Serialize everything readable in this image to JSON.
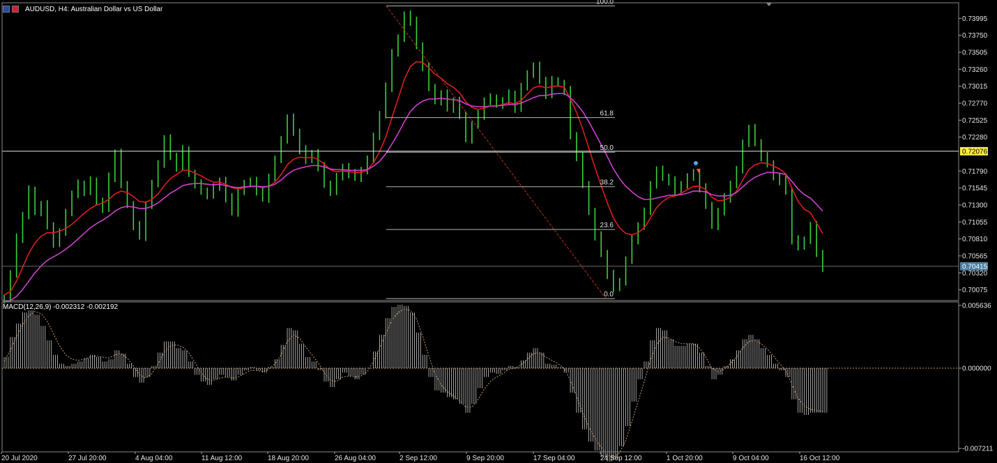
{
  "window": {
    "symbol_title": "AUDUSD, H4:  Australian Dollar vs US Dollar",
    "flag_icons": [
      "flag-au-icon",
      "flag-us-icon"
    ]
  },
  "macd_header": "MACD(12,26,9) -0.002312 -0.002192",
  "colors": {
    "background": "#000000",
    "candle": "#3cd23c",
    "ma_fast": "#e01e1e",
    "ma_slow": "#d040d0",
    "fib": "#b8b8b8",
    "fib_diagonal": "#b4321e",
    "macd_hist": "#d0d0d0",
    "macd_signal": "#c89a6a",
    "current_price_bg": "#4b7da0",
    "hline_price_bg": "#ffee44"
  },
  "chart_data": [
    {
      "type": "line",
      "name": "price",
      "title": "AUDUSD, H4:  Australian Dollar vs US Dollar",
      "ylim": [
        0.6992,
        0.7422
      ],
      "y_tick_labels": [
        "0.73995",
        "0.73750",
        "0.73505",
        "0.73260",
        "0.73015",
        "0.72770",
        "0.72525",
        "0.72280",
        "0.71790",
        "0.71545",
        "0.71300",
        "0.71055",
        "0.70810",
        "0.70565",
        "0.70320",
        "0.70075"
      ],
      "y_ticks": [
        0.73995,
        0.7375,
        0.73505,
        0.7326,
        0.73015,
        0.7277,
        0.72525,
        0.7228,
        0.7179,
        0.71545,
        0.713,
        0.71055,
        0.7081,
        0.70565,
        0.7032,
        0.70075
      ],
      "x_tick_labels": [
        "20 Jul 2020",
        "27 Jul 20:00",
        "4 Aug 04:00",
        "11 Aug 12:00",
        "18 Aug 20:00",
        "26 Aug 04:00",
        "2 Sep 12:00",
        "9 Sep 20:00",
        "17 Sep 04:00",
        "24 Sep 12:00",
        "1 Oct 20:00",
        "9 Oct 04:00",
        "16 Oct 12:00"
      ],
      "series": [
        {
          "name": "close",
          "values": [
            0.6996,
            0.703,
            0.7082,
            0.7115,
            0.7152,
            0.712,
            0.713,
            0.71,
            0.7075,
            0.709,
            0.712,
            0.7145,
            0.716,
            0.715,
            0.7165,
            0.7135,
            0.7125,
            0.717,
            0.7205,
            0.716,
            0.713,
            0.71,
            0.7085,
            0.713,
            0.716,
            0.719,
            0.7225,
            0.72,
            0.7185,
            0.721,
            0.7175,
            0.716,
            0.715,
            0.7145,
            0.7155,
            0.7165,
            0.714,
            0.712,
            0.715,
            0.716,
            0.7165,
            0.715,
            0.714,
            0.717,
            0.7195,
            0.7225,
            0.7255,
            0.7235,
            0.721,
            0.7195,
            0.7205,
            0.7185,
            0.716,
            0.715,
            0.717,
            0.7185,
            0.7175,
            0.717,
            0.718,
            0.7195,
            0.723,
            0.726,
            0.73,
            0.735,
            0.737,
            0.7405,
            0.7395,
            0.736,
            0.733,
            0.73,
            0.728,
            0.729,
            0.727,
            0.728,
            0.726,
            0.7225,
            0.7245,
            0.726,
            0.728,
            0.7285,
            0.7275,
            0.728,
            0.729,
            0.727,
            0.73,
            0.732,
            0.733,
            0.731,
            0.729,
            0.731,
            0.7305,
            0.7295,
            0.723,
            0.72,
            0.716,
            0.712,
            0.7085,
            0.706,
            0.703,
            0.701,
            0.702,
            0.705,
            0.708,
            0.71,
            0.712,
            0.716,
            0.718,
            0.717,
            0.7165,
            0.715,
            0.716,
            0.717,
            0.7175,
            0.7155,
            0.713,
            0.71,
            0.712,
            0.714,
            0.716,
            0.718,
            0.722,
            0.724,
            0.722,
            0.72,
            0.719,
            0.717,
            0.7165,
            0.715,
            0.708,
            0.707,
            0.708,
            0.71,
            0.706,
            0.704
          ]
        },
        {
          "name": "ma_fast",
          "values": [
            0.7,
            0.7005,
            0.702,
            0.704,
            0.706,
            0.7075,
            0.7085,
            0.709,
            0.709,
            0.7092,
            0.7096,
            0.7102,
            0.711,
            0.7118,
            0.7125,
            0.713,
            0.7133,
            0.7138,
            0.7146,
            0.715,
            0.7148,
            0.7142,
            0.7135,
            0.7134,
            0.7138,
            0.7146,
            0.7158,
            0.7168,
            0.7174,
            0.718,
            0.718,
            0.7176,
            0.7172,
            0.7167,
            0.7163,
            0.7163,
            0.716,
            0.7155,
            0.7153,
            0.7155,
            0.7157,
            0.7157,
            0.7155,
            0.7157,
            0.7163,
            0.7174,
            0.7188,
            0.7196,
            0.7199,
            0.7198,
            0.7199,
            0.7196,
            0.7189,
            0.7181,
            0.7178,
            0.7179,
            0.7178,
            0.7177,
            0.7177,
            0.718,
            0.7191,
            0.7207,
            0.7228,
            0.7256,
            0.7283,
            0.7311,
            0.733,
            0.7337,
            0.7336,
            0.7328,
            0.7319,
            0.7313,
            0.7305,
            0.73,
            0.7292,
            0.7279,
            0.7271,
            0.7268,
            0.727,
            0.7273,
            0.7273,
            0.7275,
            0.7278,
            0.7276,
            0.7281,
            0.729,
            0.7299,
            0.7302,
            0.7299,
            0.7301,
            0.7302,
            0.73,
            0.7283,
            0.7264,
            0.724,
            0.7212,
            0.7184,
            0.7158,
            0.7133,
            0.7111,
            0.7097,
            0.7089,
            0.7087,
            0.709,
            0.7097,
            0.7111,
            0.7126,
            0.7135,
            0.7141,
            0.7143,
            0.7147,
            0.7152,
            0.7157,
            0.7157,
            0.7152,
            0.7141,
            0.7136,
            0.7137,
            0.7141,
            0.715,
            0.7166,
            0.7181,
            0.7188,
            0.7191,
            0.719,
            0.7186,
            0.7182,
            0.7175,
            0.7154,
            0.7135,
            0.7124,
            0.7119,
            0.7104,
            0.7089
          ]
        },
        {
          "name": "ma_slow",
          "values": [
            0.699,
            0.6992,
            0.6998,
            0.7008,
            0.702,
            0.7032,
            0.7042,
            0.705,
            0.7055,
            0.706,
            0.7066,
            0.7073,
            0.7081,
            0.7089,
            0.7097,
            0.7103,
            0.7108,
            0.7114,
            0.7121,
            0.7126,
            0.7128,
            0.7127,
            0.7125,
            0.7125,
            0.7128,
            0.7133,
            0.714,
            0.7147,
            0.7152,
            0.7158,
            0.716,
            0.7161,
            0.7161,
            0.716,
            0.7159,
            0.716,
            0.7158,
            0.7156,
            0.7155,
            0.7156,
            0.7157,
            0.7157,
            0.7156,
            0.7157,
            0.716,
            0.7166,
            0.7174,
            0.718,
            0.7183,
            0.7185,
            0.7187,
            0.7187,
            0.7185,
            0.7182,
            0.7181,
            0.7181,
            0.718,
            0.718,
            0.718,
            0.7181,
            0.7186,
            0.7193,
            0.7204,
            0.7218,
            0.7233,
            0.725,
            0.7265,
            0.7274,
            0.728,
            0.7283,
            0.7283,
            0.7284,
            0.7283,
            0.7282,
            0.7281,
            0.7276,
            0.7273,
            0.7272,
            0.7272,
            0.7273,
            0.7273,
            0.7274,
            0.7275,
            0.7275,
            0.7277,
            0.7281,
            0.7285,
            0.7288,
            0.7288,
            0.729,
            0.7291,
            0.7291,
            0.7285,
            0.7276,
            0.7265,
            0.725,
            0.7234,
            0.7217,
            0.72,
            0.7182,
            0.7168,
            0.7157,
            0.7149,
            0.7142,
            0.7138,
            0.7138,
            0.714,
            0.7142,
            0.7144,
            0.7144,
            0.7145,
            0.7147,
            0.715,
            0.715,
            0.7149,
            0.7145,
            0.7143,
            0.7143,
            0.7144,
            0.7148,
            0.7156,
            0.7164,
            0.717,
            0.7174,
            0.7177,
            0.7177,
            0.7176,
            0.7174,
            0.7164,
            0.7153,
            0.7145,
            0.714,
            0.7131,
            0.7121
          ]
        }
      ],
      "fibonacci": {
        "levels": [
          {
            "label": "100.0",
            "price": 0.74175
          },
          {
            "label": "61.8",
            "price": 0.72562
          },
          {
            "label": "50.0",
            "price": 0.72063
          },
          {
            "label": "38.2",
            "price": 0.71564
          },
          {
            "label": "23.6",
            "price": 0.70946
          },
          {
            "label": "0.0",
            "price": 0.69948
          }
        ]
      },
      "horizontal_line": {
        "price": 0.72076,
        "label": "0.72076"
      },
      "current_price": {
        "price": 0.70415,
        "label": "0.70415"
      }
    },
    {
      "type": "bar",
      "name": "MACD",
      "title": "MACD(12,26,9) -0.002312 -0.002192",
      "ylim": [
        -0.00752,
        0.00595
      ],
      "y_tick_labels": [
        "0.005636",
        "0.000000",
        "-0.007211"
      ],
      "y_ticks": [
        0.005636,
        0.0,
        -0.007211
      ],
      "series": [
        {
          "name": "macd",
          "values": [
            0.001,
            0.0028,
            0.004,
            0.005,
            0.0052,
            0.0048,
            0.0038,
            0.0025,
            0.0012,
            0.0004,
            0.0002,
            0.0004,
            0.0006,
            0.0009,
            0.0012,
            0.001,
            0.0006,
            0.0008,
            0.0016,
            0.0013,
            0.0004,
            -0.0008,
            -0.0013,
            -0.0008,
            0.0002,
            0.0014,
            0.0024,
            0.0024,
            0.0018,
            0.0016,
            0.0006,
            -0.0006,
            -0.0012,
            -0.0015,
            -0.001,
            -0.0006,
            -0.0008,
            -0.0011,
            -0.0006,
            -0.0002,
            0.0001,
            -0.0002,
            -0.0004,
            0.0001,
            0.0008,
            0.0021,
            0.0036,
            0.0034,
            0.0022,
            0.001,
            0.0006,
            -0.0002,
            -0.0012,
            -0.0017,
            -0.001,
            -0.0004,
            -0.0007,
            -0.001,
            -0.0006,
            0.0,
            0.0015,
            0.003,
            0.0045,
            0.0055,
            0.0057,
            0.0056,
            0.005,
            0.0032,
            0.0012,
            -0.0008,
            -0.002,
            -0.0022,
            -0.0026,
            -0.0028,
            -0.0032,
            -0.004,
            -0.0032,
            -0.0018,
            -0.0008,
            -0.0004,
            -0.0005,
            -0.0002,
            0.0002,
            0.0001,
            0.0007,
            0.0014,
            0.0018,
            0.0014,
            0.0004,
            0.0003,
            0.0001,
            -0.0004,
            -0.0022,
            -0.004,
            -0.0055,
            -0.0066,
            -0.0074,
            -0.008,
            -0.0084,
            -0.0082,
            -0.007,
            -0.0052,
            -0.003,
            -0.001,
            0.0006,
            0.0025,
            0.0036,
            0.0034,
            0.0026,
            0.002,
            0.002,
            0.0022,
            0.0022,
            0.0014,
            0.0002,
            -0.001,
            -0.0006,
            0.0002,
            0.0008,
            0.0016,
            0.0026,
            0.003,
            0.0026,
            0.0018,
            0.0012,
            0.0004,
            -0.0002,
            -0.0008,
            -0.0028,
            -0.004,
            -0.0042,
            -0.004,
            -0.004,
            -0.004
          ]
        },
        {
          "name": "signal",
          "values": [
            0.0006,
            0.0016,
            0.0028,
            0.0039,
            0.0047,
            0.0051,
            0.0049,
            0.0042,
            0.0031,
            0.002,
            0.0012,
            0.0008,
            0.0007,
            0.0008,
            0.001,
            0.0011,
            0.001,
            0.0009,
            0.0012,
            0.0013,
            0.0009,
            0.0002,
            -0.0006,
            -0.0009,
            -0.0005,
            0.0004,
            0.0014,
            0.002,
            0.0021,
            0.0019,
            0.0014,
            0.0005,
            -0.0004,
            -0.001,
            -0.0011,
            -0.0009,
            -0.0008,
            -0.0009,
            -0.0008,
            -0.0005,
            -0.0002,
            -0.0002,
            -0.0003,
            -0.0001,
            0.0004,
            0.0012,
            0.0024,
            0.003,
            0.0027,
            0.0019,
            0.0012,
            0.0005,
            -0.0004,
            -0.0011,
            -0.0012,
            -0.0008,
            -0.0007,
            -0.0008,
            -0.0007,
            -0.0003,
            0.0006,
            0.0018,
            0.0031,
            0.0043,
            0.005,
            0.0053,
            0.0052,
            0.0044,
            0.0029,
            0.0011,
            -0.0005,
            -0.0015,
            -0.0021,
            -0.0025,
            -0.0029,
            -0.0035,
            -0.0035,
            -0.0028,
            -0.0019,
            -0.0012,
            -0.0008,
            -0.0005,
            -0.0001,
            0.0,
            0.0003,
            0.0008,
            0.0013,
            0.0014,
            0.001,
            0.0007,
            0.0004,
            0.0,
            -0.0011,
            -0.0025,
            -0.004,
            -0.0053,
            -0.0063,
            -0.0071,
            -0.0078,
            -0.008,
            -0.0076,
            -0.0065,
            -0.0048,
            -0.003,
            -0.0012,
            0.0007,
            0.0021,
            0.0028,
            0.0027,
            0.0024,
            0.0022,
            0.0022,
            0.0022,
            0.0018,
            0.001,
            0.0,
            -0.0003,
            -0.0001,
            0.0004,
            0.001,
            0.0018,
            0.0024,
            0.0025,
            0.0022,
            0.0017,
            0.0011,
            0.0004,
            -0.0002,
            -0.0015,
            -0.0027,
            -0.0034,
            -0.0037,
            -0.0038,
            -0.0039
          ]
        }
      ]
    }
  ]
}
